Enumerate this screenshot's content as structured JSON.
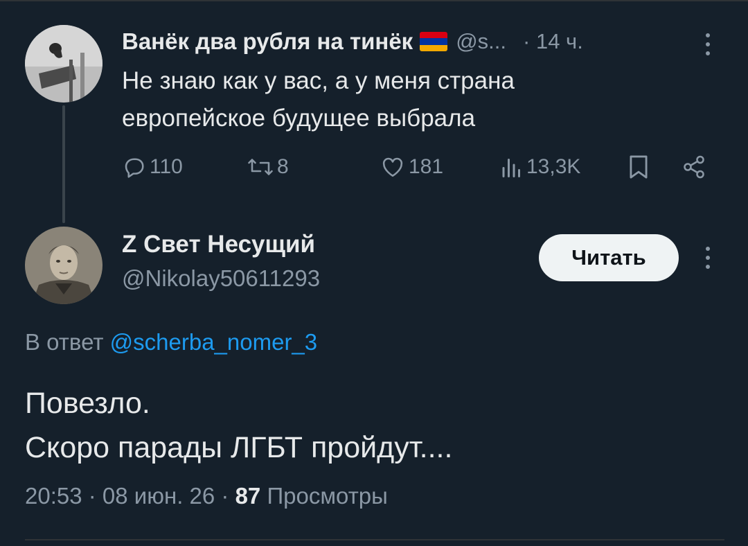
{
  "parent_tweet": {
    "author_name": "Ванёк два рубля на тинёк",
    "flag_colors": [
      "#d90012",
      "#0033a0",
      "#f2a800"
    ],
    "handle": "@s...",
    "time": "· 14 ч.",
    "text_lines": [
      "Не знаю как у вас, а у меня страна",
      "европейское будущее выбрала"
    ],
    "stats": {
      "replies": "110",
      "retweets": "8",
      "likes": "181",
      "views": "13,3K"
    },
    "icons": [
      "reply-icon",
      "retweet-icon",
      "like-icon",
      "views-icon",
      "bookmark-icon",
      "share-icon",
      "more-icon"
    ]
  },
  "main_tweet": {
    "author_name": "Z Свет Несущий",
    "handle": "@Nikolay50611293",
    "follow_label": "Читать",
    "reply_prefix": "В ответ",
    "reply_mention": "@scherba_nomer_3",
    "text_lines": [
      "Повезло.",
      "Скоро парады ЛГБТ пройдут...."
    ],
    "timestamp": "20:53 · 08 июн. 26 · ",
    "views_count": "87",
    "views_label": " Просмотры"
  },
  "colors": {
    "background": "#15202b",
    "text_primary": "#e7e9ea",
    "text_secondary": "#8b98a5",
    "accent": "#1d9bf0",
    "button_bg": "#eff3f4"
  }
}
